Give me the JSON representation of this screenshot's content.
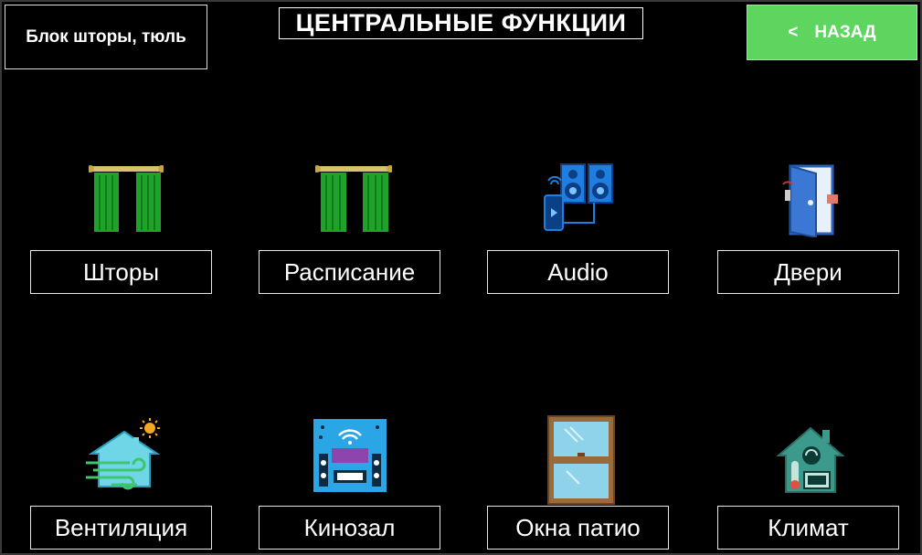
{
  "header": {
    "block_label": "Блок шторы, тюль",
    "title": "ЦЕНТРАЛЬНЫЕ ФУНКЦИИ",
    "back_chevron": "<",
    "back_label": "НАЗАД"
  },
  "tiles": [
    {
      "label": "Шторы",
      "icon": "curtain-icon"
    },
    {
      "label": "Расписание",
      "icon": "curtain-schedule-icon"
    },
    {
      "label": "Audio",
      "icon": "speakers-icon"
    },
    {
      "label": "Двери",
      "icon": "door-icon"
    },
    {
      "label": "Вентиляция",
      "icon": "ventilation-house-icon"
    },
    {
      "label": "Кинозал",
      "icon": "home-cinema-icon"
    },
    {
      "label": "Окна патио",
      "icon": "window-icon"
    },
    {
      "label": "Климат",
      "icon": "climate-house-icon"
    }
  ],
  "colors": {
    "background": "#000000",
    "back_button": "#5dd55f",
    "curtain_green": "#1fa22a",
    "curtain_rod": "#d9c36a",
    "speaker_blue": "#1e7fe0",
    "cinema_blue": "#2aa5e6",
    "window_frame": "#9a6a3a",
    "climate_teal": "#3c9a8c"
  }
}
